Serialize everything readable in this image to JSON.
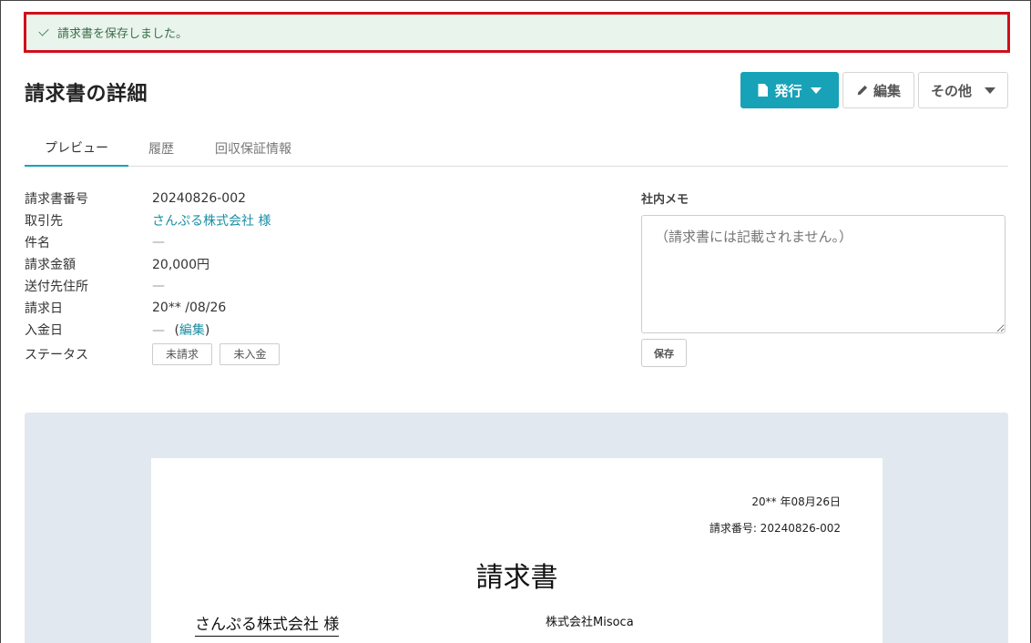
{
  "flash": {
    "message": "請求書を保存しました。"
  },
  "header": {
    "title": "請求書の詳細"
  },
  "toolbar": {
    "issue_label": "発行",
    "edit_label": "編集",
    "more_label": "その他"
  },
  "tabs": [
    {
      "label": "プレビュー",
      "active": true
    },
    {
      "label": "履歴",
      "active": false
    },
    {
      "label": "回収保証情報",
      "active": false
    }
  ],
  "details": {
    "invoice_no": {
      "label": "請求書番号",
      "value": "20240826-002"
    },
    "client": {
      "label": "取引先",
      "value": "さんぷる株式会社 様"
    },
    "subject": {
      "label": "件名",
      "value": "—"
    },
    "amount": {
      "label": "請求金額",
      "value": "20,000円"
    },
    "ship_to": {
      "label": "送付先住所",
      "value": "—"
    },
    "invoice_date": {
      "label": "請求日",
      "value": "20** /08/26"
    },
    "payment_date": {
      "label": "入金日",
      "value": "—",
      "open": "(",
      "link": "編集",
      "close": ")"
    },
    "status": {
      "label": "ステータス",
      "badges": [
        "未請求",
        "未入金"
      ]
    }
  },
  "memo": {
    "label": "社内メモ",
    "placeholder": "（請求書には記載されません。）",
    "save_label": "保存"
  },
  "preview": {
    "date": "20** 年08月26日",
    "invoice_no": "請求番号: 20240826-002",
    "title": "請求書",
    "client": "さんぷる株式会社 様",
    "issuer": "株式会社Misoca"
  },
  "colors": {
    "accent": "#17a2b8",
    "flash_bg": "#e9f4ec",
    "flash_border": "#d0101a",
    "preview_bg": "#e2e8f0"
  }
}
